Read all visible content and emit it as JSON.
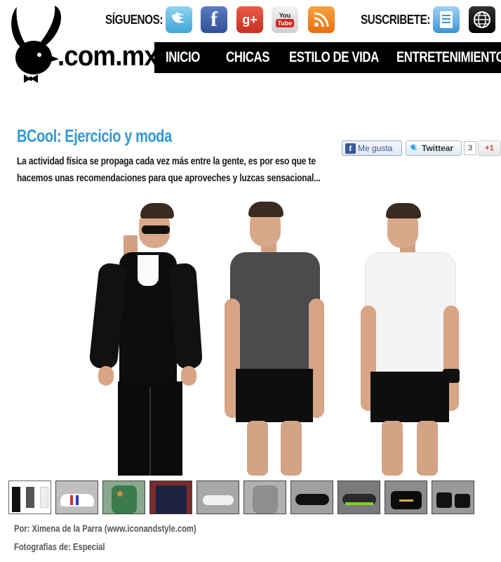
{
  "site": {
    "logo_text": ".com.mx",
    "follow_label": "SÍGUENOS:",
    "subscribe_label": "SUSCRIBETE:",
    "social_icons": [
      "twitter-icon",
      "facebook-icon",
      "google-plus-icon",
      "youtube-icon",
      "rss-icon"
    ],
    "youtube_you": "You",
    "youtube_tube": "Tube",
    "facebook_glyph": "f",
    "gplus_glyph": "g+",
    "subscribe_icons": [
      "newsletter-icon",
      "globe-icon"
    ]
  },
  "nav": {
    "items": [
      {
        "label": "INICIO"
      },
      {
        "label": "CHICAS"
      },
      {
        "label": "ESTILO DE VIDA"
      },
      {
        "label": "ENTRETENIMIENTO"
      }
    ]
  },
  "article": {
    "title": "BCool: Ejercicio y moda",
    "intro": "La actividad física se propaga cada vez más entre la gente, es por eso que te hacemos unas recomendaciones para que aproveches y luzcas sensacional...",
    "byline": "Por: Ximena de la Parra (www.iconandstyle.com)",
    "photo_credit": "Fotografías de: Especial"
  },
  "share": {
    "like_label": "Me gusta",
    "tweet_label": "Twittear",
    "tweet_count": "3",
    "gplus_label": "+1"
  },
  "colors": {
    "title_blue": "#2f9ad6",
    "nav_bg": "#000000"
  }
}
